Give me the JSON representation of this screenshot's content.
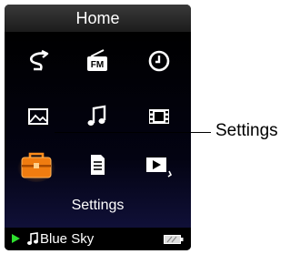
{
  "header": {
    "title": "Home"
  },
  "menu": {
    "selected_label": "Settings",
    "items": [
      {
        "icon": "repeat-icon"
      },
      {
        "icon": "fm-radio-icon",
        "text": "FM"
      },
      {
        "icon": "clock-icon"
      },
      {
        "icon": "photo-icon"
      },
      {
        "icon": "music-icon"
      },
      {
        "icon": "video-icon"
      },
      {
        "icon": "settings-toolbox-icon"
      },
      {
        "icon": "document-icon"
      },
      {
        "icon": "slideshow-icon"
      }
    ]
  },
  "now_playing": {
    "track": "Blue Sky",
    "play_icon": "play-icon",
    "note_icon": "music-note-icon",
    "battery_icon": "battery-icon"
  },
  "annotation": {
    "label": "Settings"
  },
  "colors": {
    "accent": "#f07c10",
    "play": "#2ee02e",
    "background": "#000000"
  }
}
